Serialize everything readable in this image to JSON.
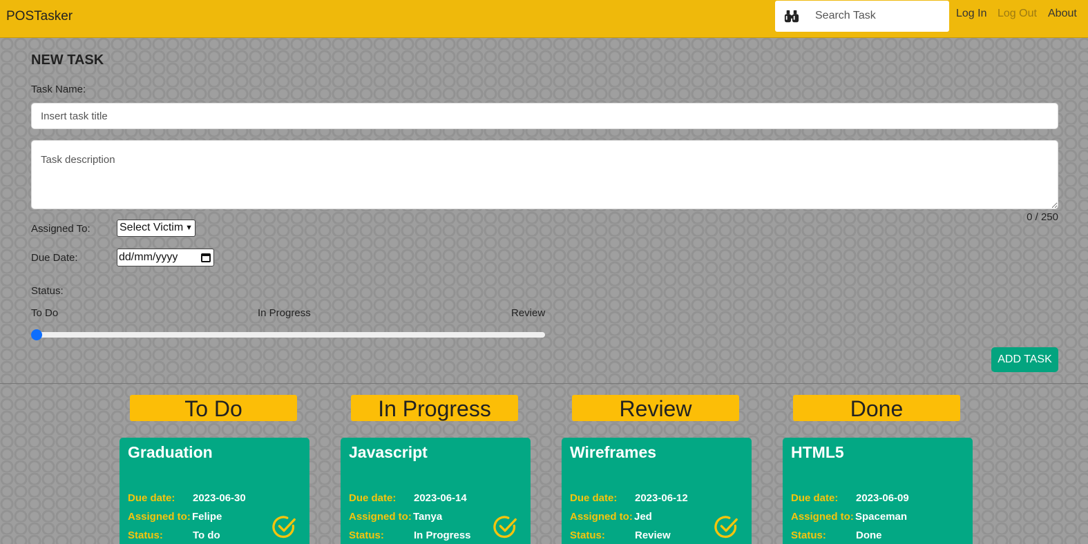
{
  "navbar": {
    "brand": "POSTasker",
    "search_placeholder": "Search Task",
    "login": "Log In",
    "logout": "Log Out",
    "about": "About",
    "search_icon": "binoculars-icon"
  },
  "form": {
    "title": "NEW TASK",
    "task_name_label": "Task Name:",
    "task_name_placeholder": "Insert task title",
    "description_placeholder": "Task description",
    "char_counter": "0 / 250",
    "assigned_label": "Assigned To:",
    "assigned_value": "Select Victim",
    "due_label": "Due Date:",
    "due_value": "dd/mm/yyyy",
    "status_label": "Status:",
    "status_options": [
      "To Do",
      "In Progress",
      "Review"
    ],
    "status_value_index": 0,
    "add_button": "ADD TASK"
  },
  "columns": [
    "To Do",
    "In Progress",
    "Review",
    "Done"
  ],
  "card_labels": {
    "due": "Due date:",
    "assigned": "Assigned to:",
    "status": "Status:"
  },
  "cards": [
    {
      "title": "Graduation",
      "due": "2023-06-30",
      "assigned": "Felipe",
      "status": "To do"
    },
    {
      "title": "Javascript",
      "due": "2023-06-14",
      "assigned": "Tanya",
      "status": "In Progress"
    },
    {
      "title": "Wireframes",
      "due": "2023-06-12",
      "assigned": "Jed",
      "status": "Review"
    },
    {
      "title": "HTML5",
      "due": "2023-06-09",
      "assigned": "Spaceman",
      "status": "Done"
    }
  ],
  "colors": {
    "navbar": "#efb90b",
    "column_header": "#fcbe07",
    "card": "#03a884",
    "card_label": "#f8c40c",
    "button": "#03a47f",
    "slider_thumb": "#0d6efd"
  }
}
